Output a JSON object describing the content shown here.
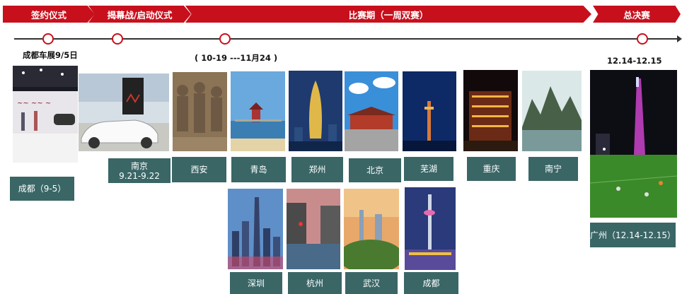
{
  "phases": [
    "签约仪式",
    "揭幕战/启动仪式",
    "比赛期（一周双赛）",
    "总决赛"
  ],
  "notes": {
    "expo": "成都车展9/5日",
    "period": "( 10-19 ---11月24 )",
    "final": "12.14-12.15"
  },
  "cities": {
    "chengdu_signing": "成都（9-5）",
    "nanjing_line1": "南京",
    "nanjing_line2": "9.21-9.22",
    "xian": "西安",
    "qingdao": "青岛",
    "zhengzhou": "郑州",
    "beijing": "北京",
    "wuhu": "芜湖",
    "chongqing": "重庆",
    "nanning": "南宁",
    "shenzhen": "深圳",
    "hangzhou": "杭州",
    "wuhan": "武汉",
    "chengdu": "成都",
    "guangzhou": "广州（12.14-12.15）"
  },
  "colors": {
    "phase_red": "#c8101d",
    "label_teal": "#3a6666",
    "timeline": "#333333"
  }
}
